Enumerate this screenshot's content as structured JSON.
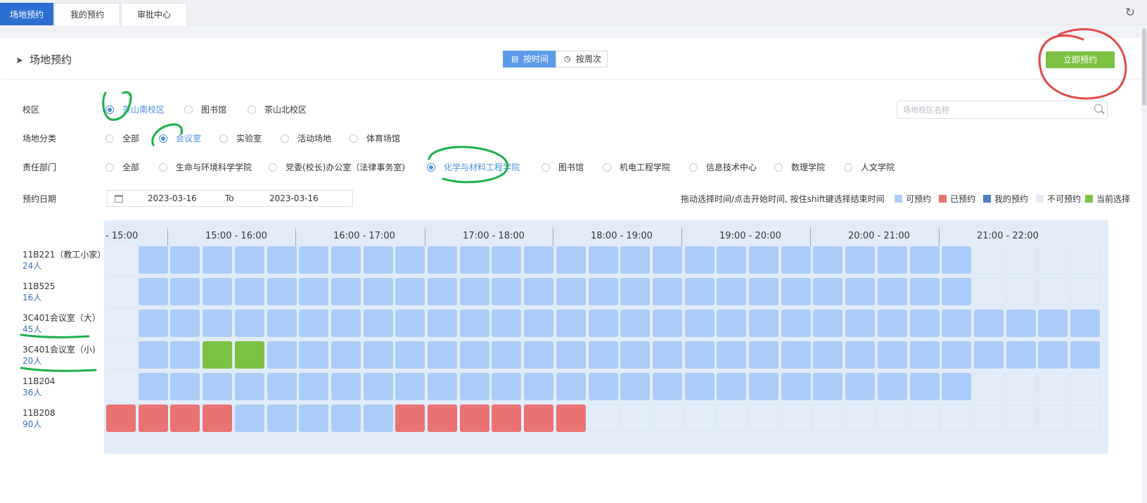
{
  "top_tabs": [
    {
      "label": "场地预约",
      "active": true
    },
    {
      "label": "我的预约",
      "active": false
    },
    {
      "label": "审批中心",
      "active": false
    }
  ],
  "panel": {
    "title": "场地预约",
    "view_by_time": "按时间",
    "view_by_week": "按周次",
    "book_now": "立即预约"
  },
  "filters": {
    "campus": {
      "label": "校区",
      "options": [
        "茶山南校区",
        "图书馆",
        "茶山北校区"
      ],
      "selected": "茶山南校区"
    },
    "category": {
      "label": "场地分类",
      "options": [
        "全部",
        "会议室",
        "实验室",
        "活动场地",
        "体育场馆"
      ],
      "selected": "会议室"
    },
    "department": {
      "label": "责任部门",
      "options": [
        "全部",
        "生命与环境科学学院",
        "党委(校长)办公室（法律事务室)",
        "化学与材料工程学院",
        "图书馆",
        "机电工程学院",
        "信息技术中心",
        "数理学院",
        "人文学院"
      ],
      "selected": "化学与材料工程学院"
    },
    "date": {
      "label": "预约日期",
      "start": "2023-03-16",
      "to": "To",
      "end": "2023-03-16"
    },
    "search_placeholder": "场地校区名称"
  },
  "hint": "拖动选择时间/点击开始时间, 按住shift键选择结束时间",
  "legend": [
    {
      "label": "可预约",
      "color": "#a9cdf7"
    },
    {
      "label": "已预约",
      "color": "#e97272"
    },
    {
      "label": "我的预约",
      "color": "#4f7fbf"
    },
    {
      "label": "不可预约",
      "color": "#e3edf9"
    },
    {
      "label": "当前选择",
      "color": "#7cc242"
    }
  ],
  "time_headers": [
    "- 15:00",
    "15:00 - 16:00",
    "16:00 - 17:00",
    "17:00 - 18:00",
    "18:00 - 19:00",
    "19:00 - 20:00",
    "20:00 - 21:00",
    "21:00 - 22:00"
  ],
  "rooms": [
    {
      "name": "11B221（教工小家）",
      "capacity": "24人",
      "slots": "EFFFFFFFFFFFFFFFFFFFFFFFFFFUUUU"
    },
    {
      "name": "11B525",
      "capacity": "16人",
      "slots": "EFFFFFFFFFFFFFFFFFFFFFFFFFFUUUU"
    },
    {
      "name": "3C401会议室（大）",
      "capacity": "45人",
      "slots": "EFFFFFFFFFFFFFFFFFFFFFFFFFFFFFF"
    },
    {
      "name": "3C401会议室（小)",
      "capacity": "20人",
      "slots": "EFFSSFFFFFFFFFFFFFFFFFFFFFFFFFF"
    },
    {
      "name": "11B204",
      "capacity": "36人",
      "slots": "EFFFFFFFFFFFFFFFFFFFFFFFFFFUUUU"
    },
    {
      "name": "11B208",
      "capacity": "90人",
      "slots": "BBBBFFFFFBBBBBBUUUUUUUUUUUUUUUU"
    }
  ]
}
